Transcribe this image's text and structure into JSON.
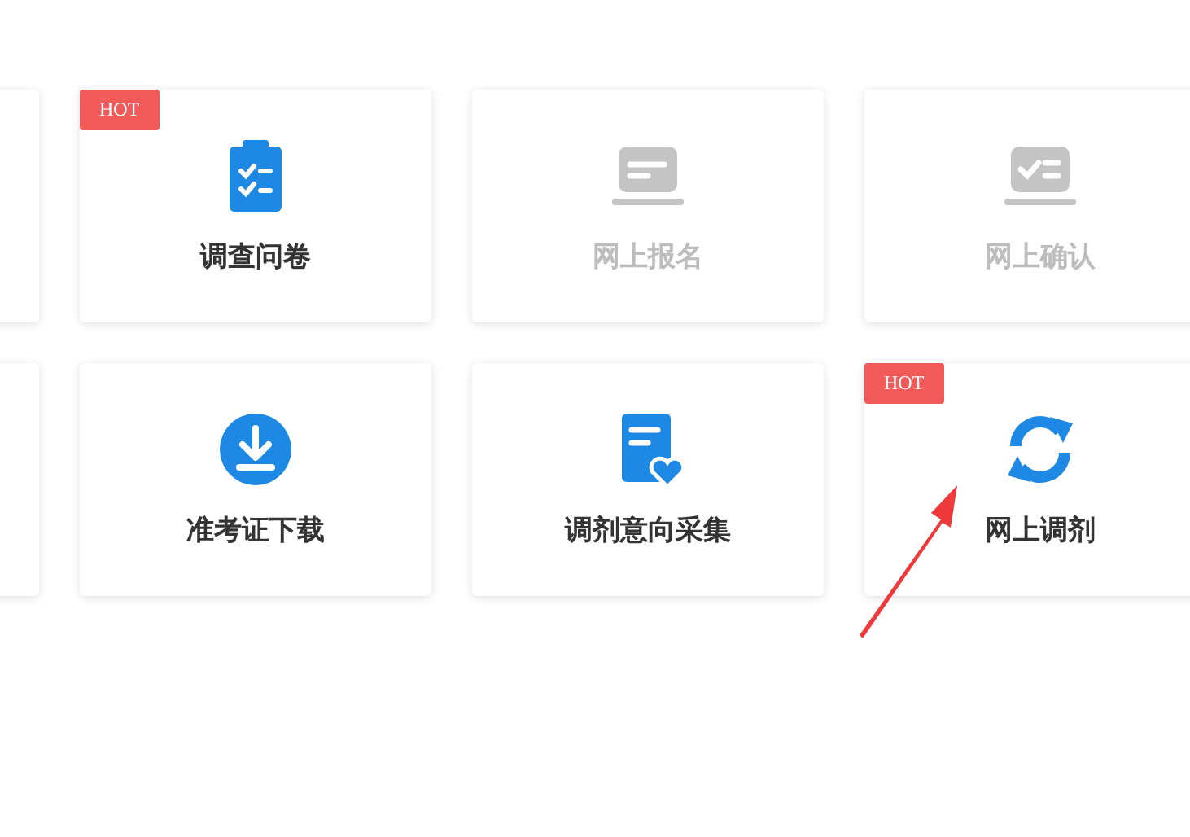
{
  "rows": [
    {
      "cards": [
        {
          "kind": "clipboard",
          "label": "调查问卷",
          "hot": true,
          "badge": "HOT",
          "disabled": false
        },
        {
          "kind": "monitor-bar",
          "label": "网上报名",
          "hot": false,
          "disabled": true
        },
        {
          "kind": "monitor-check",
          "label": "网上确认",
          "hot": false,
          "disabled": true
        }
      ]
    },
    {
      "cards": [
        {
          "kind": "download",
          "label": "准考证下载",
          "hot": false,
          "disabled": false
        },
        {
          "kind": "doc-heart",
          "label": "调剂意向采集",
          "hot": false,
          "disabled": false
        },
        {
          "kind": "refresh",
          "label": "网上调剂",
          "hot": true,
          "badge": "HOT",
          "disabled": false
        }
      ]
    }
  ],
  "annotation": {
    "kind": "arrow",
    "color": "#f0393a"
  }
}
